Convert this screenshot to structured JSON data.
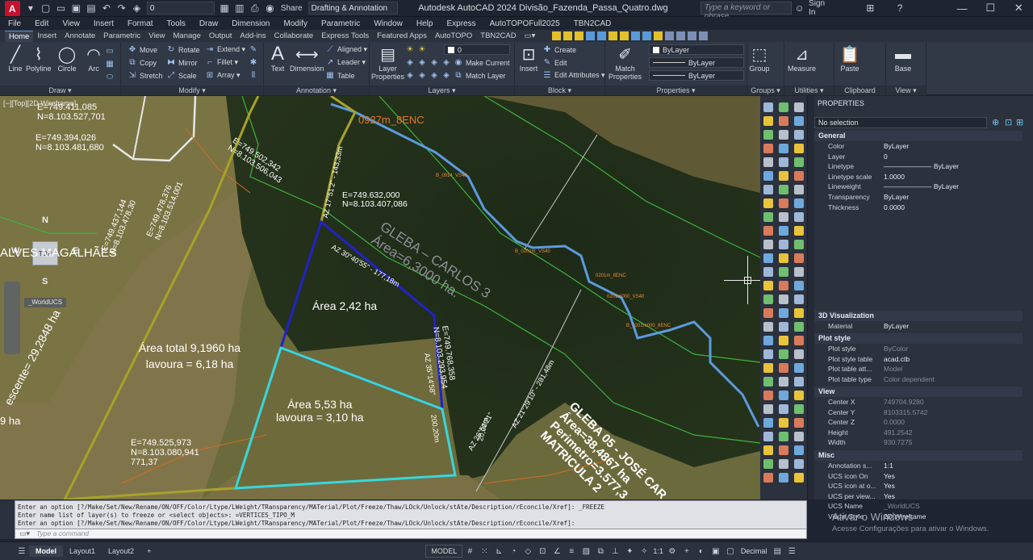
{
  "titlebar": {
    "layer_field": "0",
    "share": "Share",
    "workspace": "Drafting & Annotation",
    "title": "Autodesk AutoCAD 2024   Divisão_Fazenda_Passa_Quatro.dwg",
    "search_placeholder": "Type a keyword or phrase",
    "sign_in": "Sign In"
  },
  "menus": [
    "File",
    "Edit",
    "View",
    "Insert",
    "Format",
    "Tools",
    "Draw",
    "Dimension",
    "Modify",
    "Parametric",
    "Window",
    "Help",
    "Express",
    "AutoTOPOFull2025",
    "TBN2CAD"
  ],
  "ribbon_tabs": [
    "Home",
    "Insert",
    "Annotate",
    "Parametric",
    "View",
    "Manage",
    "Output",
    "Add-ins",
    "Collaborate",
    "Express Tools",
    "Featured Apps",
    "AutoTOPO",
    "TBN2CAD"
  ],
  "ribbon": {
    "draw": {
      "title": "Draw ▾",
      "line": "Line",
      "polyline": "Polyline",
      "circle": "Circle",
      "arc": "Arc"
    },
    "modify": {
      "title": "Modify ▾",
      "move": "Move",
      "rotate": "Rotate",
      "extend": "Extend ▾",
      "copy": "Copy",
      "mirror": "Mirror",
      "fillet": "Fillet ▾",
      "stretch": "Stretch",
      "scale": "Scale",
      "array": "Array ▾"
    },
    "annotation": {
      "title": "Annotation ▾",
      "text": "Text",
      "dimension": "Dimension",
      "aligned": "Aligned ▾",
      "leader": "Leader ▾",
      "table": "Table"
    },
    "layers": {
      "title": "Layers ▾",
      "layer_properties": "Layer\nProperties",
      "layer_value": "0",
      "make_current": "Make Current",
      "match_layer": "Match Layer"
    },
    "block": {
      "title": "Block ▾",
      "insert": "Insert",
      "create": "Create",
      "edit": "Edit",
      "edit_attributes": "Edit Attributes ▾"
    },
    "properties": {
      "title": "Properties ▾",
      "match": "Match\nProperties",
      "by1": "ByLayer",
      "by2": "ByLayer",
      "by3": "ByLayer"
    },
    "groups": {
      "title": "Groups ▾",
      "group": "Group"
    },
    "utilities": {
      "title": "Utilities ▾",
      "measure": "Measure"
    },
    "clipboard": {
      "title": "Clipboard",
      "paste": "Paste"
    },
    "view": {
      "title": "View ▾",
      "base": "Base"
    }
  },
  "viewport": {
    "label": "[−][Top][2D Wireframe]",
    "compass": {
      "n": "N",
      "s": "S",
      "e": "E",
      "w": "W",
      "top": "TOP"
    },
    "wcs": "_WorldUCS",
    "labels": {
      "c1": "E=749.411,085",
      "c1b": "N=8.103.527,701",
      "c2": "E=749.394,026",
      "c2b": "N=8.103.481,680",
      "c3": "E=749.502,342",
      "c3b": "N=8.103.506,043",
      "c4": "E=749.632,000",
      "c4b": "N=8.103.407,086",
      "c5": "E=749.478,376",
      "c5b": "N=8.103.514,001",
      "c6": "E=749.437,144",
      "c6b": "N=8.103.478,30",
      "c7": "E=749.768,358",
      "c7b": "N=8.103.293,954",
      "c8": "E=749.525,973",
      "c8b": "N=8.103.080,941",
      "c8c": "771,37",
      "enc": "0927m_8ENC",
      "gleba3a": "GLEBA – CARLOS 3",
      "gleba3b": "Área=6,3000 ha.",
      "area1": "Área  2,42 ha",
      "area_total1": "Área total 9,1960 ha",
      "area_total2": "lavoura = 6,18 ha",
      "area2a": "Área  5,53 ha",
      "area2b": "lavoura = 3,10 ha",
      "gleba5a": "GLEBA 05 - JOSÉ CAR",
      "gleba5b": "Área=38,4867 ha",
      "gleba5c": "Perimetro=3.577,3",
      "gleba5d": "MATRICULA 2",
      "magalhaes": "ALVES MAGALHÃES",
      "crescente": "escente= 29,2848 ha",
      "ha9": "9 ha",
      "az1": "AZ 30°40'55\" - 177,18m",
      "az2": "AZ 35°14'58\"",
      "az3": "AZ 17°51'2\" - 143,33m",
      "dist1": "200,20m",
      "dist2": "20,00m",
      "dist3": "AZ 26°51'21\"",
      "dist4": "AZ 21°29'10\" - 281,48m",
      "v1": "B_0914_VS40",
      "v2": "B_0201m_VS40",
      "v3": "0201m_8ENC",
      "v4": "0201m000_VS40",
      "v5": "B_0201m000_8ENC"
    }
  },
  "properties": {
    "title": "PROPERTIES",
    "selection": "No selection",
    "sections": {
      "general": "General",
      "viz3d": "3D Visualization",
      "plotstyle": "Plot style",
      "view": "View",
      "misc": "Misc"
    },
    "general": [
      {
        "label": "Color",
        "value": "ByLayer"
      },
      {
        "label": "Layer",
        "value": "0"
      },
      {
        "label": "Linetype",
        "value": "——————— ByLayer"
      },
      {
        "label": "Linetype scale",
        "value": "1.0000"
      },
      {
        "label": "Lineweight",
        "value": "——————— ByLayer"
      },
      {
        "label": "Transparency",
        "value": "ByLayer"
      },
      {
        "label": "Thickness",
        "value": "0.0000"
      }
    ],
    "viz3d": [
      {
        "label": "Material",
        "value": "ByLayer"
      }
    ],
    "plotstyle": [
      {
        "label": "Plot style",
        "value": "ByColor"
      },
      {
        "label": "Plot style table",
        "value": "acad.ctb"
      },
      {
        "label": "Plot table att...",
        "value": "Model"
      },
      {
        "label": "Plot table type",
        "value": "Color dependent"
      }
    ],
    "view": [
      {
        "label": "Center X",
        "value": "749704.9280"
      },
      {
        "label": "Center Y",
        "value": "8103315.5742"
      },
      {
        "label": "Center Z",
        "value": "0.0000"
      },
      {
        "label": "Height",
        "value": "491.2542"
      },
      {
        "label": "Width",
        "value": "930.7275"
      }
    ],
    "misc": [
      {
        "label": "Annotation s...",
        "value": "1:1"
      },
      {
        "label": "UCS icon On",
        "value": "Yes"
      },
      {
        "label": "UCS icon at o...",
        "value": "Yes"
      },
      {
        "label": "UCS per view...",
        "value": "Yes"
      },
      {
        "label": "UCS Name",
        "value": "_WorldUCS"
      },
      {
        "label": "Visual Style",
        "value": "2D Wireframe"
      }
    ]
  },
  "command": {
    "lines": [
      "Enter an option [?/Make/Set/New/Rename/ON/OFF/Color/Ltype/LWeight/TRansparency/MATerial/Plot/Freeze/Thaw/LOck/Unlock/stAte/Description/rEconcile/Xref]: _FREEZE",
      "Enter name list of layer(s) to freeze or <select objects>: =VERTICES_TIPO_M",
      "Enter an option [?/Make/Set/New/Rename/ON/OFF/Color/Ltype/LWeight/TRansparency/MATerial/Plot/Freeze/Thaw/LOck/Unlock/stAte/Description/rEconcile/Xref]:"
    ],
    "placeholder": "Type a command"
  },
  "windows_activation": {
    "line1": "Ativar o Windows",
    "line2": "Acesse Configurações para ativar o Windows."
  },
  "statusbar": {
    "model": "Model",
    "layout1": "Layout1",
    "layout2": "Layout2",
    "add": "+",
    "model_space": "MODEL",
    "scale": "1:1",
    "units": "Decimal"
  }
}
